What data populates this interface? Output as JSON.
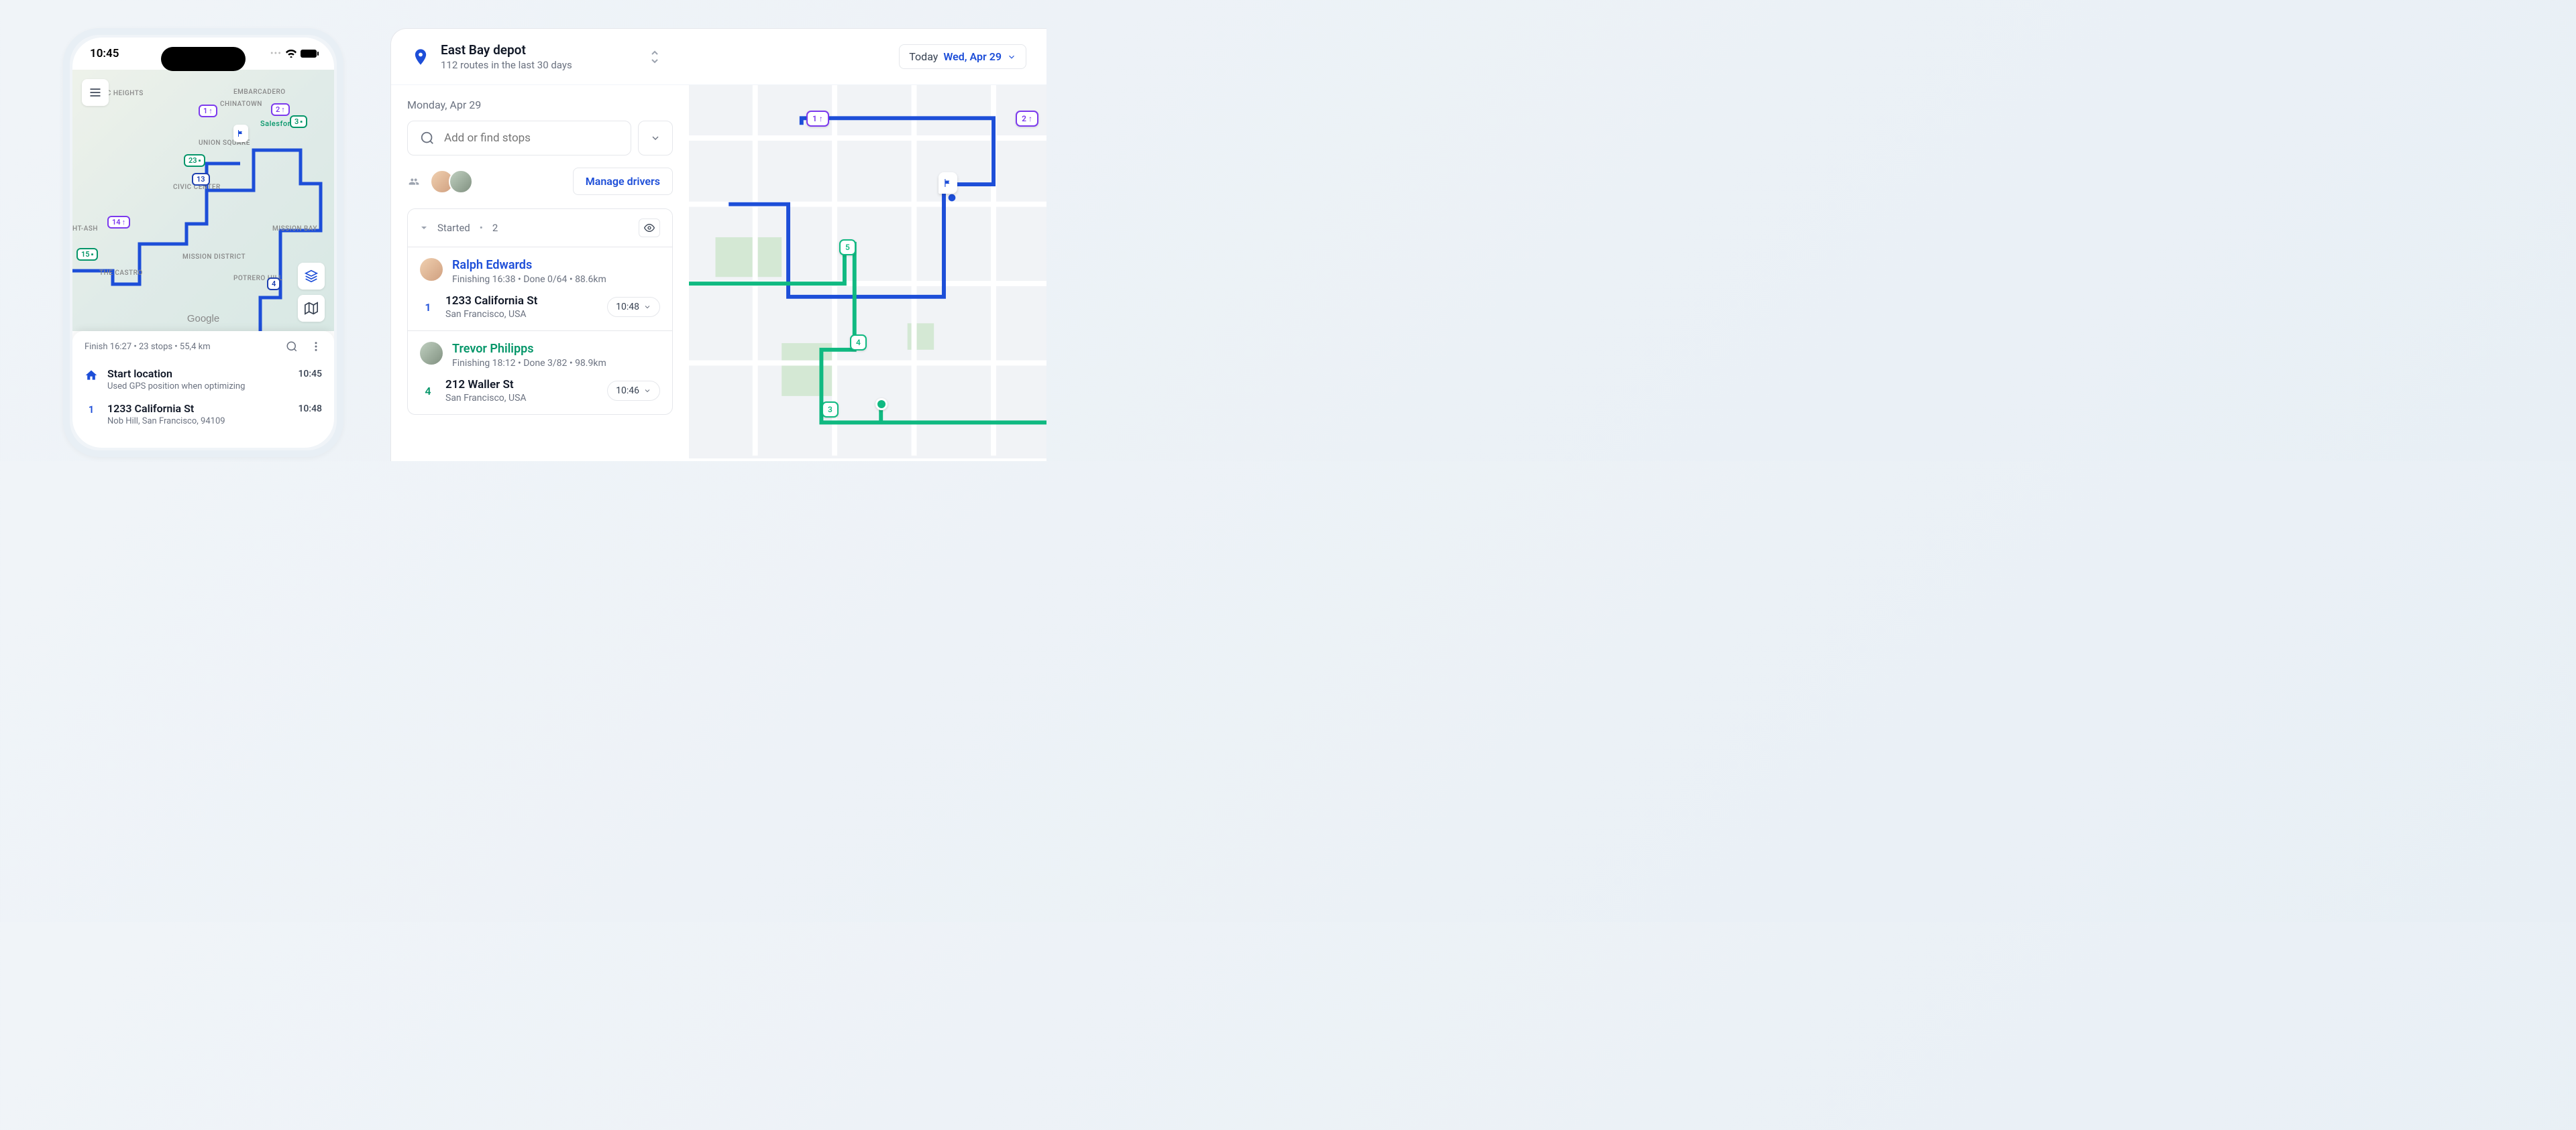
{
  "phone": {
    "time": "10:45",
    "map_markers": {
      "m1": "1",
      "m2": "2",
      "m3": "3",
      "m23": "23",
      "m13": "13",
      "m14": "14",
      "m15": "15",
      "m4": "4"
    },
    "map_labels": {
      "embarcadero": "EMBARCADERO",
      "chinatown": "CHINATOWN",
      "pacific_heights": "PACIFIC HEIGHTS",
      "union_square": "UNION SQUARE",
      "civic_center": "CIVIC CENTER",
      "mission_bay": "MISSION BAY",
      "mission_district": "MISSION DISTRICT",
      "ht_ash": "HT-ASH",
      "the_castro": "THE CASTRO",
      "potrero_hill": "POTRERO HILL",
      "salesforce": "Salesforce"
    },
    "google": "Google",
    "summary": "Finish 16:27 • 23 stops • 55,4 km",
    "start": {
      "title": "Start location",
      "sub": "Used GPS position when optimizing",
      "time": "10:45"
    },
    "stop1": {
      "num": "1",
      "title": "1233 California St",
      "sub": "Nob Hill, San Francisco, 94109",
      "time": "10:48"
    }
  },
  "desktop": {
    "depot": {
      "name": "East Bay depot",
      "sub": "112 routes in the last 30 days"
    },
    "date": {
      "label": "Today",
      "value": "Wed, Apr 29"
    },
    "day": "Monday, Apr 29",
    "search_placeholder": "Add or find stops",
    "manage": "Manage drivers",
    "section": {
      "status": "Started",
      "count": "2"
    },
    "driver1": {
      "name": "Ralph Edwards",
      "meta": "Finishing 16:38 • Done 0/64 • 88.6km",
      "stop_num": "1",
      "stop_title": "1233 California St",
      "stop_sub": "San Francisco, USA",
      "stop_time": "10:48"
    },
    "driver2": {
      "name": "Trevor Philipps",
      "meta": "Finishing 18:12 • Done 3/82 • 98.9km",
      "stop_num": "4",
      "stop_title": "212 Waller St",
      "stop_sub": "San Francisco, USA",
      "stop_time": "10:46"
    },
    "map_pins": {
      "p1": "1",
      "p2": "2",
      "p5": "5",
      "p4": "4",
      "p3": "3"
    }
  }
}
